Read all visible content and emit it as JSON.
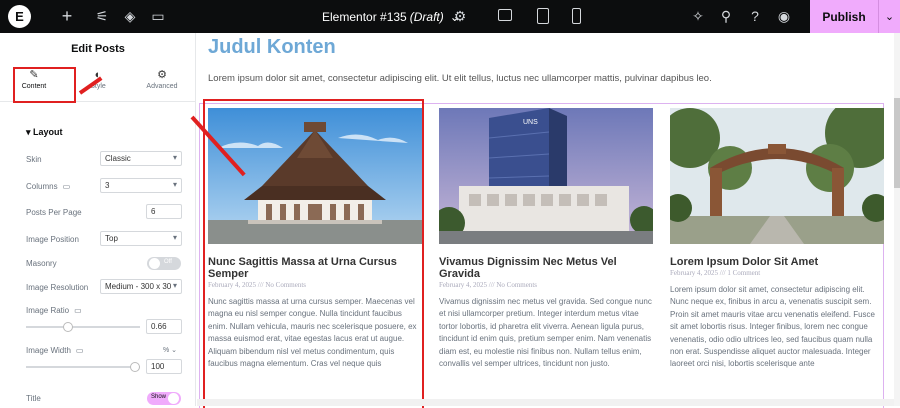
{
  "topbar": {
    "logo": "E",
    "add_icon": "+",
    "doc_title": "Elementor #135",
    "doc_status": "(Draft)",
    "chevron": "⌄",
    "publish": "Publish",
    "publish_more": "⌄"
  },
  "panel": {
    "title": "Edit Posts",
    "tabs": [
      {
        "icon": "✎",
        "label": "Content"
      },
      {
        "icon": "◐",
        "label": "Style"
      },
      {
        "icon": "⚙",
        "label": "Advanced"
      }
    ],
    "section": "Layout",
    "fields": {
      "skin": {
        "label": "Skin",
        "value": "Classic"
      },
      "columns": {
        "label": "Columns",
        "value": "3"
      },
      "posts_per_page": {
        "label": "Posts Per Page",
        "value": "6"
      },
      "image_position": {
        "label": "Image Position",
        "value": "Top"
      },
      "masonry": {
        "label": "Masonry",
        "value": "Off"
      },
      "image_resolution": {
        "label": "Image Resolution",
        "value": "Medium - 300 x 30"
      },
      "image_ratio": {
        "label": "Image Ratio",
        "value": "0.66",
        "slider_fraction": 0.36
      },
      "image_width": {
        "label": "Image Width",
        "unit": "% ⌄",
        "value": "100",
        "slider_fraction": 1.0
      },
      "title": {
        "label": "Title",
        "value": "Show"
      }
    }
  },
  "canvas": {
    "heading": "Judul Konten",
    "intro": "Lorem ipsum dolor sit amet, consectetur adipiscing elit. Ut elit tellus, luctus nec ullamcorper mattis, pulvinar dapibus leo.",
    "cards": [
      {
        "title": "Nunc Sagittis Massa at Urna Cursus Semper",
        "meta": "February 4, 2025 /// No Comments",
        "excerpt": "Nunc sagittis massa at urna cursus semper. Maecenas vel magna eu nisl semper congue. Nulla tincidunt faucibus enim. Nullam vehicula, mauris nec scelerisque posuere, ex massa euismod erat, vitae egestas lacus erat ut augue. Aliquam bibendum nisl vel metus condimentum, quis faucibus magna elementum. Cras vel neque quis"
      },
      {
        "title": "Vivamus Dignissim Nec Metus Vel Gravida",
        "meta": "February 4, 2025 /// No Comments",
        "excerpt": "Vivamus dignissim nec metus vel gravida. Sed congue nunc et nisi ullamcorper pretium. Integer interdum metus vitae tortor lobortis, id pharetra elit viverra. Aenean ligula purus, tincidunt id enim quis, pretium semper enim. Nam venenatis diam est, eu molestie nisi finibus non. Nullam tellus enim, convallis vel semper ultrices, tincidunt non justo."
      },
      {
        "title": "Lorem Ipsum Dolor Sit Amet",
        "meta": "February 4, 2025 /// 1 Comment",
        "excerpt": "Lorem ipsum dolor sit amet, consectetur adipiscing elit. Nunc neque ex, finibus in arcu a, venenatis suscipit sem. Proin sit amet mauris vitae arcu venenatis eleifend. Fusce sit amet lobortis risus. Integer finibus, lorem nec congue venenatis, odio odio ultrices leo, sed faucibus quam nulla non erat. Suspendisse aliquet auctor malesuada. Integer laoreet orci nisi, lobortis scelerisque ante"
      }
    ],
    "building_sign": "UNS"
  },
  "colors": {
    "accent": "#f0abfc",
    "annotation": "#e02020",
    "heading": "#6ea8d6"
  }
}
